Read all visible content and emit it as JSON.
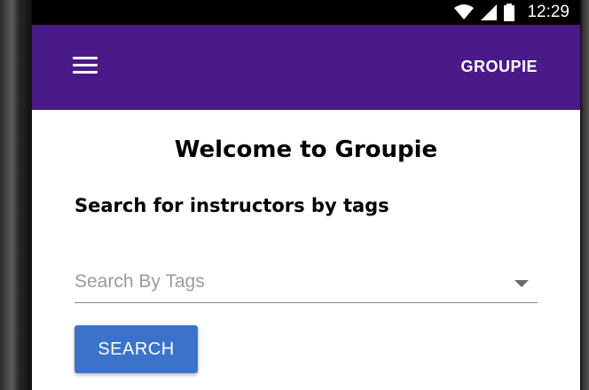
{
  "status_bar": {
    "time": "12:29",
    "icons": [
      "wifi-icon",
      "cellular-signal-icon",
      "battery-icon"
    ]
  },
  "app_bar": {
    "menu_icon": "hamburger-menu-icon",
    "logo_text": "GROUPIE",
    "background": "#4a1a89"
  },
  "main": {
    "title": "Welcome to Groupie",
    "section_title": "Search for instructors by tags",
    "tag_select": {
      "placeholder": "Search By Tags"
    },
    "search_button_label": "SEARCH",
    "accent": "#3a73c9"
  }
}
